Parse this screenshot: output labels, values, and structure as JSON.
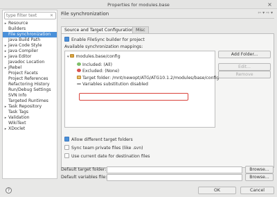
{
  "window": {
    "title": "Properties for modules.base",
    "close": "×"
  },
  "sidebar": {
    "filter_placeholder": "type filter text",
    "items": [
      {
        "label": "Resource",
        "arrow": "▸"
      },
      {
        "label": "Builders",
        "arrow": ""
      },
      {
        "label": "File synchronization",
        "arrow": ""
      },
      {
        "label": "Java Build Path",
        "arrow": ""
      },
      {
        "label": "Java Code Style",
        "arrow": "▸"
      },
      {
        "label": "Java Compiler",
        "arrow": "▸"
      },
      {
        "label": "Java Editor",
        "arrow": "▸"
      },
      {
        "label": "Javadoc Location",
        "arrow": ""
      },
      {
        "label": "JRebel",
        "arrow": "▸"
      },
      {
        "label": "Project Facets",
        "arrow": ""
      },
      {
        "label": "Project References",
        "arrow": ""
      },
      {
        "label": "Refactoring History",
        "arrow": ""
      },
      {
        "label": "Run/Debug Settings",
        "arrow": ""
      },
      {
        "label": "SVN Info",
        "arrow": ""
      },
      {
        "label": "Targeted Runtimes",
        "arrow": ""
      },
      {
        "label": "Task Repository",
        "arrow": "▸"
      },
      {
        "label": "Task Tags",
        "arrow": ""
      },
      {
        "label": "Validation",
        "arrow": "▸"
      },
      {
        "label": "WikiText",
        "arrow": ""
      },
      {
        "label": "XDoclet",
        "arrow": "▸"
      }
    ]
  },
  "header": {
    "title": "File synchronization",
    "icons": "⇦ ▾ ⇨ ▾"
  },
  "tabs": [
    {
      "label": "Source and Target Configuration"
    },
    {
      "label": "Misc"
    }
  ],
  "panel": {
    "enable_label": "Enable FileSync builder for project",
    "mappings_label": "Available synchronization mappings:",
    "tree": {
      "root": "modules.base/config",
      "included": "Included: (All)",
      "excluded": "Excluded: (None)",
      "target": "Target folder: /mnt/newopt/ATG/ATG10.1.2/modules/base/config",
      "vars": "Variables substitution disabled"
    },
    "buttons": {
      "add": "Add Folder...",
      "edit": "Edit...",
      "remove": "Remove"
    },
    "allow_label": "Allow different target folders",
    "sync_label": "Sync team private files (like .svn)",
    "current_label": "Use current date for destination files",
    "default_target_label": "Default target folder:",
    "default_vars_label": "Default variables file:",
    "browse": "Browse..."
  },
  "footer": {
    "help": "?",
    "ok": "OK",
    "cancel": "Cancel"
  },
  "colors": {
    "accent": "#4a90d9",
    "highlight": "#d9413a"
  }
}
